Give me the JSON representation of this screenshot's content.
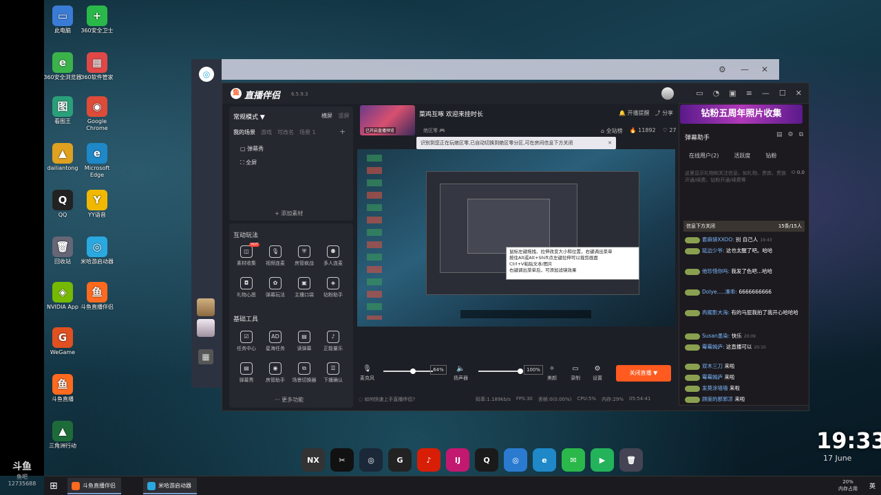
{
  "left_strip": {
    "logo": "斗鱼",
    "sub": "鱼吧",
    "room": "12735688"
  },
  "desktop_icons": [
    {
      "label": "此电脑",
      "glyph": "▭",
      "color": "#3a7bd5"
    },
    {
      "label": "360安全卫士",
      "glyph": "+",
      "color": "#2ab84a"
    },
    {
      "label": "360安全浏览器",
      "glyph": "e",
      "color": "#3bb34a"
    },
    {
      "label": "360软件管家",
      "glyph": "▦",
      "color": "#e04848"
    },
    {
      "label": "看图王",
      "glyph": "图",
      "color": "#2aa07a"
    },
    {
      "label": "Google Chrome",
      "glyph": "◉",
      "color": "#dd4b39"
    },
    {
      "label": "dailiantong",
      "glyph": "▲",
      "color": "#e0a020"
    },
    {
      "label": "Microsoft Edge",
      "glyph": "e",
      "color": "#1e88c8"
    },
    {
      "label": "QQ",
      "glyph": "Q",
      "color": "#222"
    },
    {
      "label": "YY语音",
      "glyph": "Y",
      "color": "#f0b800"
    },
    {
      "label": "回收站",
      "glyph": "🗑",
      "color": "#667"
    },
    {
      "label": "米哈游启动器",
      "glyph": "◎",
      "color": "#2aa8e0"
    },
    {
      "label": "NVIDIA App",
      "glyph": "◈",
      "color": "#76b900"
    },
    {
      "label": "斗鱼直播伴侣",
      "glyph": "鱼",
      "color": "#ff6a1f"
    },
    {
      "label": "WeGame",
      "glyph": "G",
      "color": "#e05020"
    },
    {
      "label": "斗鱼直播",
      "glyph": "鱼",
      "color": "#ff6a1f"
    },
    {
      "label": "三角洲行动",
      "glyph": "▲",
      "color": "#1e6b3a"
    }
  ],
  "app": {
    "name": "直播伴侣",
    "version": "6.5.9.3",
    "mode": "常规模式 ▼",
    "landscape": "横屏",
    "portrait": "竖屏",
    "scene_tabs": [
      "我的场景",
      "游戏",
      "可改名",
      "场景 1"
    ],
    "scene_items": [
      "弹幕秀",
      "全屏"
    ],
    "add_material": "+ 添加素材",
    "interactive_title": "互动玩法",
    "interactive_tools": [
      "素材收集",
      "视频连麦",
      "房管疯战",
      "多人连麦",
      "礼物心愿",
      "弹幕玩法",
      "主播口袋",
      "钻粉助手"
    ],
    "hot_label": "HOT",
    "basic_title": "基础工具",
    "basic_tools": [
      "任务中心",
      "星海任务",
      "读弹幕",
      "正能量乐",
      "弹幕秀",
      "房管助手",
      "场景切换器",
      "下播确认"
    ],
    "more": "··· 更多功能"
  },
  "room": {
    "thumb_label": "已开启直播预览",
    "title": "菜鸡互啄 欢迎来挂时长",
    "category": "绝区零",
    "reminder": "开播提醒",
    "share": "分享",
    "rank": "全站榜",
    "hot": "11892",
    "fans": "27",
    "notice": "识别到您正在玩绝区零,已自动切换到绝区零分区,可在房间信息下方关闭",
    "tip_lines": [
      "鼠标左键拖拽、拉伸改变大小和位置，右键调出菜单",
      "按住Alt或Alt+Shift点左键拉伸可以裁剪画面",
      "Ctrl+V粘贴文本/图片",
      "右键调出菜单后，可添加滤镜效果"
    ]
  },
  "controls": {
    "mic": "麦克风",
    "mic_pct": "64%",
    "speaker": "扬声器",
    "speaker_pct": "100%",
    "beauty": "美颜",
    "record": "录制",
    "settings": "设置",
    "close_live": "关闭直播 ▼",
    "mic_level": 0.6,
    "speaker_level": 0.95
  },
  "status": {
    "help": "如何快速上手直播伴侣?",
    "bitrate": "码率:1.189kb/s",
    "fps": "FPS:30",
    "drop": "丢帧:0(0.00%)",
    "cpu": "CPU:5%",
    "mem": "内存:29%",
    "time": "05:54:41"
  },
  "danmu": {
    "banner": "钻粉五周年照片收集",
    "title": "弹幕助手",
    "tabs": [
      "在线用户(2)",
      "活跃度",
      "钻粉"
    ],
    "note": "这里显示礼物和关注信息，如礼物、贵宾、贵族开通/续费、钻粉开通/续费等",
    "gift_stat": "0.0",
    "bar": "信息下方关闭",
    "bar_count": "15条/15人",
    "messages": [
      {
        "name": "套麻袋XXOO:",
        "text": "别 自己人",
        "time": "19:43"
      },
      {
        "name": "延边少爷:",
        "text": "这也太醒了吧。哈哈",
        "time": ""
      },
      {
        "name": "他珍惜你吗:",
        "text": "我发了色吧...哈哈",
        "time": ""
      },
      {
        "name": "Dolye.....凑乖:",
        "text": "6666666666",
        "time": ""
      },
      {
        "name": "冉掘影大海:",
        "text": "有的马屁我拍了我开心哈哈哈",
        "time": ""
      },
      {
        "name": "Susan墨染:",
        "text": "快乐",
        "time": "20:09"
      },
      {
        "name": "霉霉嫣庐:",
        "text": "这直播可以",
        "time": "20:10"
      },
      {
        "name": "双木三刀",
        "text": "来啦",
        "time": ""
      },
      {
        "name": "霉霉嫣庐",
        "text": "来啦",
        "time": ""
      },
      {
        "name": "发莫涂墙墙",
        "text": "来啦",
        "time": ""
      },
      {
        "name": "顾度的那邪凉",
        "text": "来啦",
        "time": ""
      }
    ]
  },
  "clock": {
    "time": "19:33",
    "date": "17 June"
  },
  "dock": [
    {
      "name": "nexus",
      "glyph": "NX",
      "color": "#333"
    },
    {
      "name": "capcut",
      "glyph": "✂",
      "color": "#111"
    },
    {
      "name": "steam",
      "glyph": "◎",
      "color": "#1b2838"
    },
    {
      "name": "wegame",
      "glyph": "G",
      "color": "#222"
    },
    {
      "name": "netease-music",
      "glyph": "♪",
      "color": "#d81e06"
    },
    {
      "name": "jetbrains",
      "glyph": "IJ",
      "color": "#c21870"
    },
    {
      "name": "qq",
      "glyph": "Q",
      "color": "#1a1a1a"
    },
    {
      "name": "mihoyo",
      "glyph": "◎",
      "color": "#2a7bd0"
    },
    {
      "name": "edge",
      "glyph": "e",
      "color": "#1e88c8"
    },
    {
      "name": "wechat",
      "glyph": "✉",
      "color": "#2ab84a"
    },
    {
      "name": "player",
      "glyph": "▶",
      "color": "#24b35a"
    },
    {
      "name": "recycle-bin",
      "glyph": "🗑",
      "color": "#445"
    }
  ],
  "taskbar": {
    "items": [
      "斗鱼直播伴侣",
      "米哈游启动器"
    ],
    "tray_pct": "20%",
    "tray_label": "内存占用",
    "lang": "英"
  }
}
